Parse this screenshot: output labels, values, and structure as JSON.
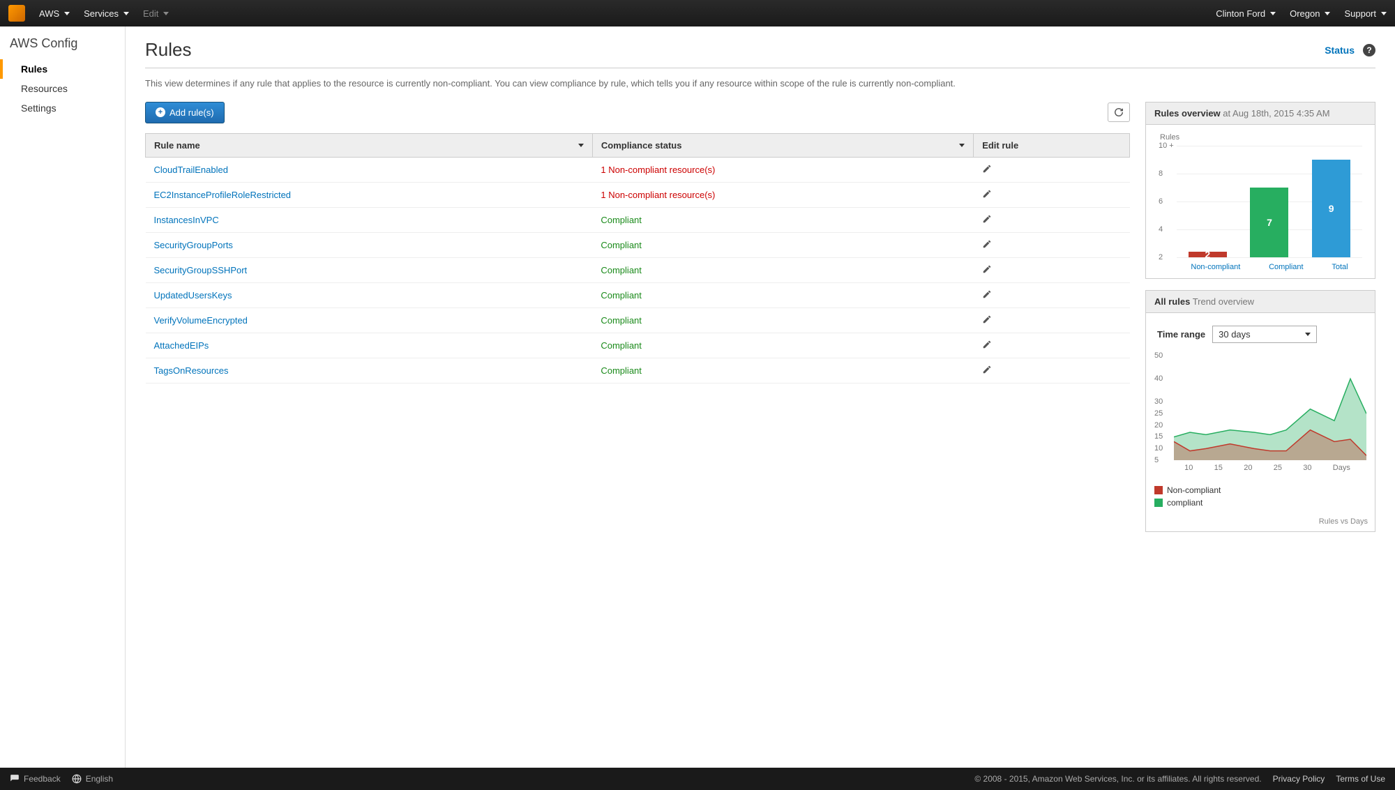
{
  "topbar": {
    "aws": "AWS",
    "services": "Services",
    "edit": "Edit",
    "user": "Clinton Ford",
    "region": "Oregon",
    "support": "Support"
  },
  "sidebar": {
    "title": "AWS Config",
    "items": [
      {
        "label": "Rules",
        "active": true
      },
      {
        "label": "Resources",
        "active": false
      },
      {
        "label": "Settings",
        "active": false
      }
    ]
  },
  "page": {
    "title": "Rules",
    "status_link": "Status",
    "description": "This view determines if any rule that applies to the resource is currently non-compliant. You can view compliance by rule, which tells you if any resource within scope of the rule is currently non-compliant."
  },
  "actions": {
    "add_label": "Add rule(s)"
  },
  "table": {
    "columns": {
      "name": "Rule name",
      "status": "Compliance status",
      "edit": "Edit rule"
    },
    "rows": [
      {
        "name": "CloudTrailEnabled",
        "status": "1 Non-compliant resource(s)",
        "compliant": false
      },
      {
        "name": "EC2InstanceProfileRoleRestricted",
        "status": "1 Non-compliant resource(s)",
        "compliant": false
      },
      {
        "name": "InstancesInVPC",
        "status": "Compliant",
        "compliant": true
      },
      {
        "name": "SecurityGroupPorts",
        "status": "Compliant",
        "compliant": true
      },
      {
        "name": "SecurityGroupSSHPort",
        "status": "Compliant",
        "compliant": true
      },
      {
        "name": "UpdatedUsersKeys",
        "status": "Compliant",
        "compliant": true
      },
      {
        "name": "VerifyVolumeEncrypted",
        "status": "Compliant",
        "compliant": true
      },
      {
        "name": "AttachedEIPs",
        "status": "Compliant",
        "compliant": true
      },
      {
        "name": "TagsOnResources",
        "status": "Compliant",
        "compliant": true
      }
    ]
  },
  "overview": {
    "title_strong": "Rules overview",
    "title_at": "at",
    "timestamp": "Aug 18th, 2015 4:35 AM",
    "axis_title": "Rules",
    "ylim": [
      2,
      10
    ],
    "ticks": [
      "10",
      "8",
      "6",
      "4",
      "2"
    ]
  },
  "trend": {
    "title_strong": "All rules",
    "title_rest": "Trend overview",
    "time_range_label": "Time range",
    "time_range_value": "30 days",
    "y_ticks": [
      "50",
      "40",
      "30",
      "25",
      "20",
      "15",
      "10",
      "5"
    ],
    "x_ticks": [
      "10",
      "15",
      "20",
      "25",
      "30"
    ],
    "x_label": "Days",
    "legend_nc": "Non-compliant",
    "legend_c": "compliant",
    "footer_note": "Rules vs Days"
  },
  "footer": {
    "feedback": "Feedback",
    "language": "English",
    "copyright": "© 2008 - 2015, Amazon Web Services, Inc. or its affiliates. All rights reserved.",
    "privacy": "Privacy Policy",
    "terms": "Terms of Use"
  },
  "chart_data": [
    {
      "type": "bar",
      "title": "Rules overview",
      "ylabel": "Rules",
      "ylim": [
        0,
        10
      ],
      "categories": [
        "Non-compliant",
        "Compliant",
        "Total"
      ],
      "values": [
        2,
        7,
        9
      ],
      "colors": [
        "#c0392b",
        "#27ae60",
        "#2e9bd6"
      ]
    },
    {
      "type": "area",
      "title": "All rules Trend overview",
      "xlabel": "Days",
      "ylabel": "Rules",
      "ylim": [
        5,
        50
      ],
      "x": [
        8,
        10,
        12,
        15,
        18,
        20,
        22,
        25,
        28,
        30,
        32
      ],
      "series": [
        {
          "name": "Non-compliant",
          "color": "#c0392b",
          "values": [
            13,
            9,
            10,
            12,
            10,
            9,
            9,
            18,
            13,
            14,
            7
          ]
        },
        {
          "name": "compliant",
          "color": "#27ae60",
          "values": [
            15,
            17,
            16,
            18,
            17,
            16,
            18,
            27,
            22,
            40,
            25
          ]
        }
      ]
    }
  ]
}
